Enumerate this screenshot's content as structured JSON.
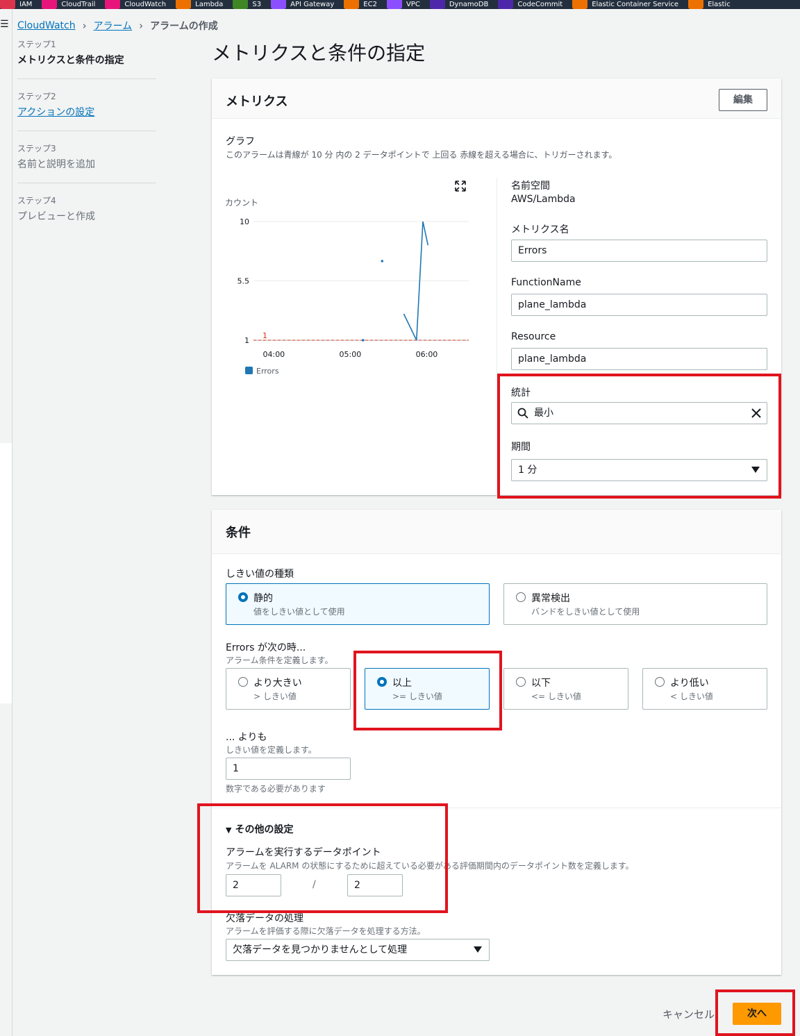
{
  "topbar": [
    {
      "label": "IAM",
      "color": "#dd344c"
    },
    {
      "label": "CloudTrail",
      "color": "#e7157b"
    },
    {
      "label": "CloudWatch",
      "color": "#e7157b"
    },
    {
      "label": "Lambda",
      "color": "#ed7100"
    },
    {
      "label": "S3",
      "color": "#3f8624"
    },
    {
      "label": "API Gateway",
      "color": "#8c4fff"
    },
    {
      "label": "EC2",
      "color": "#ed7100"
    },
    {
      "label": "VPC",
      "color": "#8c4fff"
    },
    {
      "label": "DynamoDB",
      "color": "#4d27aa"
    },
    {
      "label": "CodeCommit",
      "color": "#4d27aa"
    },
    {
      "label": "Elastic Container Service",
      "color": "#ed7100"
    },
    {
      "label": "Elastic",
      "color": "#ed7100"
    }
  ],
  "breadcrumb": {
    "root": "CloudWatch",
    "alarms": "アラーム",
    "current": "アラームの作成"
  },
  "steps": [
    {
      "num": "ステップ1",
      "label": "メトリクスと条件の指定",
      "state": "active"
    },
    {
      "num": "ステップ2",
      "label": "アクションの設定",
      "state": "link"
    },
    {
      "num": "ステップ3",
      "label": "名前と説明を追加",
      "state": "disabled"
    },
    {
      "num": "ステップ4",
      "label": "プレビューと作成",
      "state": "disabled"
    }
  ],
  "page_title": "メトリクスと条件の指定",
  "metrics_panel": {
    "title": "メトリクス",
    "edit_label": "編集",
    "graph_label": "グラフ",
    "graph_desc": "このアラームは青線が 10 分 内の 2 データポイントで 上回る 赤線を超える場合に、トリガーされます。",
    "namespace_label": "名前空間",
    "namespace_value": "AWS/Lambda",
    "metric_name_label": "メトリクス名",
    "metric_name_value": "Errors",
    "function_name_label": "FunctionName",
    "function_name_value": "plane_lambda",
    "resource_label": "Resource",
    "resource_value": "plane_lambda",
    "statistic_label": "統計",
    "statistic_value": "最小",
    "period_label": "期間",
    "period_value": "1 分"
  },
  "chart_data": {
    "type": "line",
    "ylabel": "カウント",
    "yticks": [
      "10",
      "5.5",
      "1"
    ],
    "ylim": [
      1,
      10
    ],
    "xticks": [
      "04:00",
      "05:00",
      "06:00"
    ],
    "threshold": {
      "value": 1,
      "label": "1",
      "color": "#d13212"
    },
    "series": [
      {
        "name": "Errors",
        "color": "#1f77b4",
        "segments": [
          [
            {
              "x": "05:10",
              "y": 1
            }
          ],
          [
            {
              "x": "05:25",
              "y": 7
            }
          ],
          [
            {
              "x": "05:42",
              "y": 3
            },
            {
              "x": "05:52",
              "y": 1
            },
            {
              "x": "05:57",
              "y": 10
            },
            {
              "x": "06:01",
              "y": 8.2
            }
          ]
        ]
      }
    ]
  },
  "conditions_panel": {
    "title": "条件",
    "threshold_type_label": "しきい値の種類",
    "threshold_types": [
      {
        "title": "静的",
        "desc": "値をしきい値として使用",
        "selected": true
      },
      {
        "title": "異常検出",
        "desc": "バンドをしきい値として使用",
        "selected": false
      }
    ],
    "when_label": "Errors が次の時...",
    "when_desc": "アラーム条件を定義します。",
    "operators": [
      {
        "title": "より大きい",
        "desc": "> しきい値",
        "selected": false
      },
      {
        "title": "以上",
        "desc": ">= しきい値",
        "selected": true
      },
      {
        "title": "以下",
        "desc": "<= しきい値",
        "selected": false
      },
      {
        "title": "より低い",
        "desc": "< しきい値",
        "selected": false
      }
    ],
    "than_label": "... よりも",
    "than_desc": "しきい値を定義します。",
    "than_value": "1",
    "than_hint": "数字である必要があります",
    "additional_label": "その他の設定",
    "datapoints_label": "アラームを実行するデータポイント",
    "datapoints_desc": "アラームを ALARM の状態にするために超えている必要がある評価期間内のデータポイント数を定義します。",
    "datapoints_value": "2",
    "datapoints_sep": "/",
    "evaluation_value": "2",
    "missing_label": "欠落データの処理",
    "missing_desc": "アラームを評価する際に欠落データを処理する方法。",
    "missing_value": "欠落データを見つかりませんとして処理"
  },
  "footer": {
    "cancel_label": "キャンセル",
    "next_label": "次へ"
  }
}
